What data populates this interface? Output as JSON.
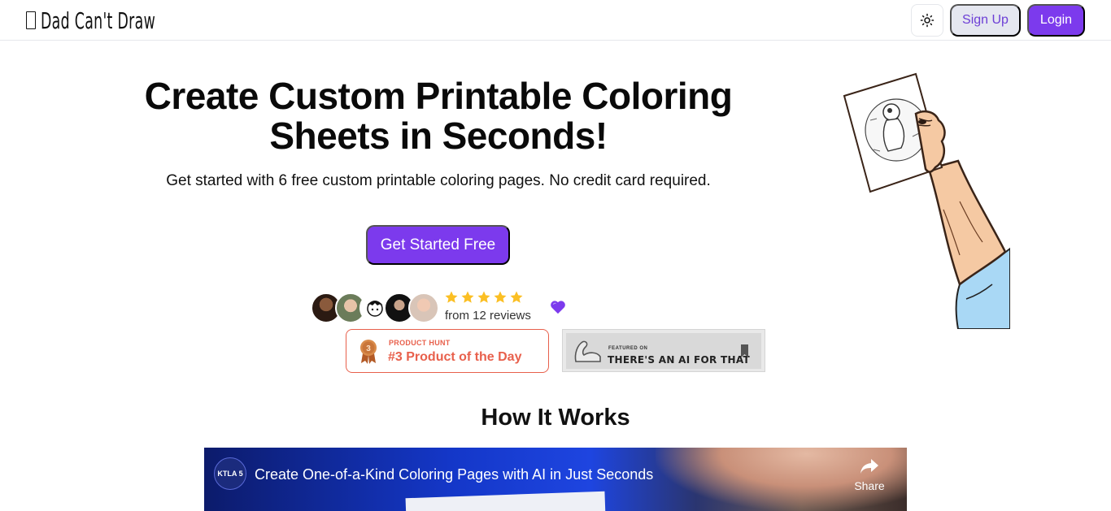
{
  "nav": {
    "logo_text": "Dad Can't Draw",
    "theme_toggle_icon": "sun-icon",
    "signup_label": "Sign Up",
    "login_label": "Login"
  },
  "hero": {
    "title_line1": "Create Custom Printable Coloring",
    "title_line2": "Sheets in Seconds!",
    "subtitle": "Get started with 6 free custom printable coloring pages. No credit card required.",
    "cta_label": "Get Started Free",
    "illustration_icon": "hand-holding-coloring-page-illustration"
  },
  "social_proof": {
    "rating": 5,
    "reviews_text": "from 12 reviews",
    "heart_icon": "purple-heart-icon",
    "star_color": "#fbbf24"
  },
  "badges": {
    "product_hunt": {
      "small_label": "PRODUCT HUNT",
      "main_label": "#3 Product of the Day",
      "medal_number": "3",
      "color": "#e8604c"
    },
    "taaft": {
      "featured_label": "FEATURED ON",
      "main_label": "THERE'S AN AI FOR THAT"
    }
  },
  "how_it_works": {
    "heading": "How It Works",
    "video": {
      "channel_logo": "KTLA 5",
      "title": "Create One-of-a-Kind Coloring Pages with AI in Just Seconds",
      "share_label": "Share"
    }
  },
  "colors": {
    "accent": "#7c3aed",
    "signup_bg": "#e5e7f0"
  }
}
